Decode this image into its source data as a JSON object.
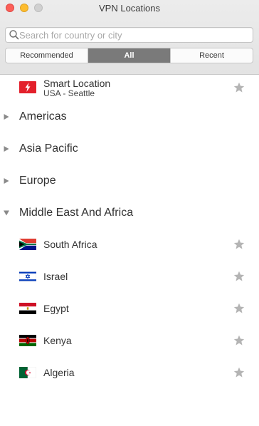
{
  "window": {
    "title": "VPN Locations"
  },
  "search": {
    "placeholder": "Search for country or city",
    "value": ""
  },
  "tabs": [
    {
      "label": "Recommended",
      "active": false
    },
    {
      "label": "All",
      "active": true
    },
    {
      "label": "Recent",
      "active": false
    }
  ],
  "smart_location": {
    "name": "Smart Location",
    "subtitle": "USA - Seattle",
    "icon": "lightning-bolt-icon",
    "favorited": false
  },
  "regions": [
    {
      "label": "Americas",
      "expanded": false
    },
    {
      "label": "Asia Pacific",
      "expanded": false
    },
    {
      "label": "Europe",
      "expanded": false
    },
    {
      "label": "Middle East And Africa",
      "expanded": true
    }
  ],
  "countries": [
    {
      "name": "South Africa",
      "flag": "south-africa-flag",
      "favorited": false
    },
    {
      "name": "Israel",
      "flag": "israel-flag",
      "favorited": false
    },
    {
      "name": "Egypt",
      "flag": "egypt-flag",
      "favorited": false
    },
    {
      "name": "Kenya",
      "flag": "kenya-flag",
      "favorited": false
    },
    {
      "name": "Algeria",
      "flag": "algeria-flag",
      "favorited": false
    }
  ],
  "colors": {
    "active_tab": "#7a7a7a",
    "smart_location_red": "#e3202b",
    "star_gray": "#b4b4b4"
  }
}
